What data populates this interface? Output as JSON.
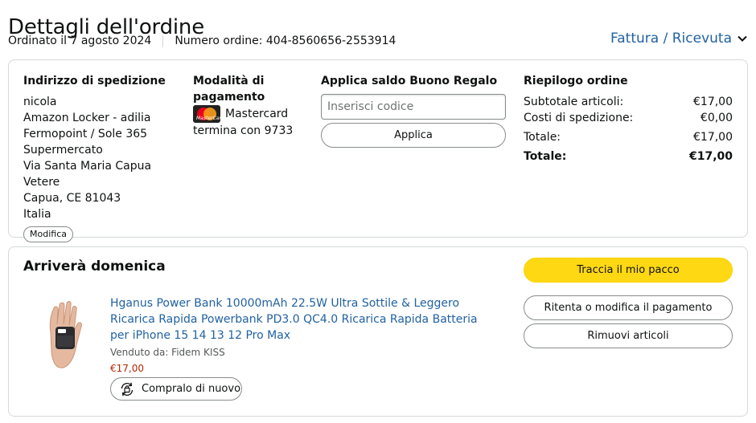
{
  "header": {
    "title": "Dettagli dell'ordine",
    "ordered_on": "Ordinato il 7 agosto 2024",
    "order_number": "Numero ordine: 404-8560656-2553914",
    "invoice_link": "Fattura / Ricevuta"
  },
  "shipping": {
    "heading": "Indirizzo di spedizione",
    "lines": [
      "nicola",
      "Amazon Locker - adilia",
      "Fermopoint / Sole 365",
      "Supermercato",
      "Via Santa Maria Capua Vetere",
      "Capua, CE 81043",
      "Italia"
    ],
    "modify_label": "Modifica"
  },
  "payment": {
    "heading": "Modalità di pagamento",
    "card_name": "Mastercard",
    "card_ending": "termina con 9733",
    "icon": "mastercard-logo"
  },
  "gift_card": {
    "heading": "Applica saldo Buono Regalo",
    "placeholder": "Inserisci codice",
    "value": "",
    "apply_label": "Applica"
  },
  "summary": {
    "heading": "Riepilogo ordine",
    "rows": [
      {
        "label": "Subtotale articoli:",
        "value": "€17,00"
      },
      {
        "label": "Costi di spedizione:",
        "value": "€0,00"
      },
      {
        "label": "Totale:",
        "value": "€17,00"
      },
      {
        "label": "Totale:",
        "value": "€17,00"
      }
    ]
  },
  "shipment": {
    "status": "Arriverà domenica",
    "product_title": "Hganus Power Bank 10000mAh 22.5W Ultra Sottile & Leggero Ricarica Rapida Powerbank PD3.0 QC4.0 Ricarica Rapida Batteria per iPhone 15 14 13 12 Pro Max",
    "seller": "Venduto da: Fidem KISS",
    "price": "€17,00",
    "buy_again_label": "Compralo di nuovo",
    "track_label": "Traccia il mio pacco",
    "retry_label": "Ritenta o modifica il pagamento",
    "remove_label": "Rimuovi articoli"
  },
  "colors": {
    "link": "#2162a1",
    "price": "#b12704",
    "primary_button": "#ffd814",
    "border": "#d5d9d9"
  }
}
